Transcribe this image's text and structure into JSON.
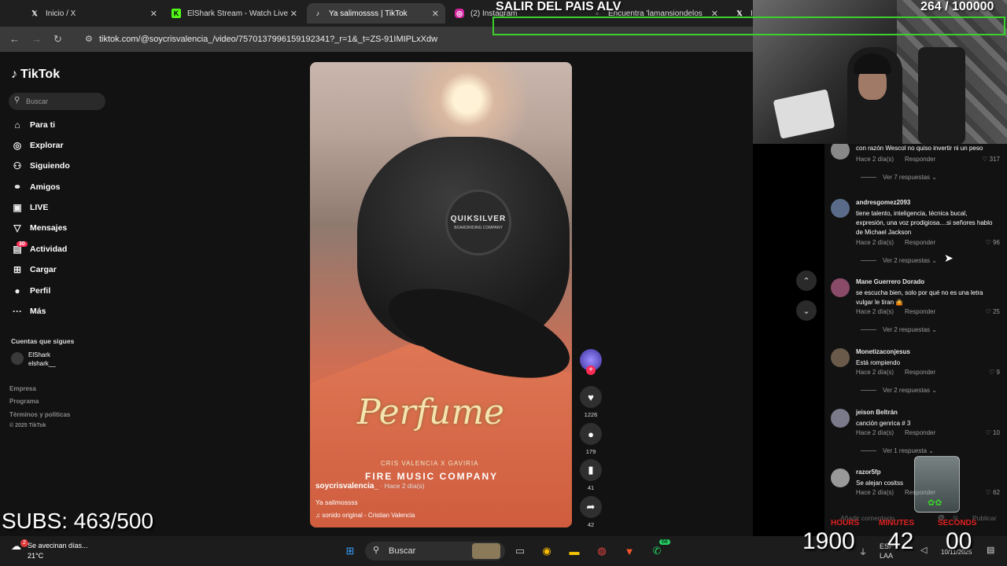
{
  "browser": {
    "tabs": [
      {
        "icon": "x-logo-icon",
        "title": "Inicio / X",
        "active": false
      },
      {
        "icon": "kick-logo-icon",
        "title": "ElShark Stream - Watch Live",
        "active": false
      },
      {
        "icon": "tiktok-logo-icon",
        "title": "Ya salimossss | TikTok",
        "active": true
      },
      {
        "icon": "instagram-logo-icon",
        "title": "(2) Instagram",
        "active": false
      },
      {
        "icon": "generic-page-icon",
        "title": "Encuentra 'lamansiondelos",
        "active": false
      },
      {
        "icon": "x-logo-icon",
        "title": "I",
        "active": false
      }
    ],
    "url": "tiktok.com/@soycrisvalencia_/video/7570137996159192341?_r=1&_t=ZS-91IMIPLxXdw"
  },
  "tiktok": {
    "brand": "TikTok",
    "search_placeholder": "Buscar",
    "nav": [
      {
        "icon": "home-icon",
        "label": "Para ti"
      },
      {
        "icon": "compass-icon",
        "label": "Explorar"
      },
      {
        "icon": "following-icon",
        "label": "Siguiendo"
      },
      {
        "icon": "friends-icon",
        "label": "Amigos"
      },
      {
        "icon": "live-icon",
        "label": "LIVE"
      },
      {
        "icon": "messages-icon",
        "label": "Mensajes"
      },
      {
        "icon": "activity-icon",
        "label": "Actividad"
      },
      {
        "icon": "upload-icon",
        "label": "Cargar"
      },
      {
        "icon": "profile-icon",
        "label": "Perfil"
      },
      {
        "icon": "more-icon",
        "label": "Más"
      }
    ],
    "activity_badge": "30",
    "following_header": "Cuentas que sigues",
    "following": [
      {
        "name": "ElShark",
        "handle": "elshark__"
      }
    ],
    "footer": [
      "Empresa",
      "Programa",
      "Términos y políticas",
      "© 2025 TikTok"
    ],
    "video": {
      "overlay_title": "Perfume",
      "overlay_credits": "CRIS VALENCIA   X GAVIRIA",
      "overlay_company": "FIRE MUSIC COMPANY",
      "cap_logo": "QUIKSILVER",
      "cap_sub": "BOARDRIDING COMPANY",
      "author": "soycrisvalencia_",
      "posted": " · Hace 2 día(s)",
      "description": "Ya salimossss",
      "sound": "sonido original - Cristian Valencia"
    },
    "actions": {
      "likes": "1226",
      "comments": "179",
      "saves": "41",
      "shares": "42"
    },
    "comments": [
      {
        "user": "",
        "text": "con razón Wescol no quiso invertir ni un peso",
        "time": "Hace 2 día(s)",
        "reply": "Responder",
        "likes": "317",
        "more": "Ver 7 respuestas ⌄"
      },
      {
        "user": "andresgomez2093",
        "text": "tiene talento, inteligencia, técnica bucal, expresión, una voz prodigiosa....si señores hablo de Michael Jackson",
        "time": "Hace 2 día(s)",
        "reply": "Responder",
        "likes": "96",
        "more": "Ver 2 respuestas ⌄"
      },
      {
        "user": "Mane Guerrero Dorado",
        "text": "se escucha bien, solo por qué no es una letra vulgar le tiran 🤷",
        "time": "Hace 2 día(s)",
        "reply": "Responder",
        "likes": "25",
        "more": "Ver 2 respuestas ⌄"
      },
      {
        "user": "Monetizaconjesus",
        "text": "Está rompiendo",
        "time": "Hace 2 día(s)",
        "reply": "Responder",
        "likes": "9",
        "more": "Ver 2 respuestas ⌄"
      },
      {
        "user": "jeison Beltrán",
        "text": "canción genrica # 3",
        "time": "Hace 2 día(s)",
        "reply": "Responder",
        "likes": "10",
        "more": "Ver 1 respuesta ⌄"
      },
      {
        "user": "razor5fp",
        "text": "Se alejan cositss",
        "time": "Hace 2 día(s)",
        "reply": "Responder",
        "likes": "62",
        "more": ""
      }
    ],
    "add_comment_placeholder": "Añadir comentario...",
    "publish": "Publicar"
  },
  "stream": {
    "goal_title": "SALIR DEL PAIS ALV",
    "goal_count": "264  / 100000",
    "subs": "SUBS: 463/500",
    "timer": {
      "hours": "1900",
      "minutes": "42",
      "seconds": "00",
      "hours_label": "HOURS",
      "minutes_label": "MINUTES",
      "seconds_label": "SECONDS"
    }
  },
  "taskbar": {
    "weather_title": "Se avecinan días...",
    "weather_temp": "21°C",
    "weather_badge": "2",
    "search": "Buscar",
    "whatsapp_badge": "68",
    "lang": "ESP",
    "lang_sub": "LAA",
    "date": "10/11/2025"
  },
  "colors": {
    "accent": "#fe2c55",
    "goal_border": "#3bd12c",
    "timer_label": "#e02020"
  }
}
